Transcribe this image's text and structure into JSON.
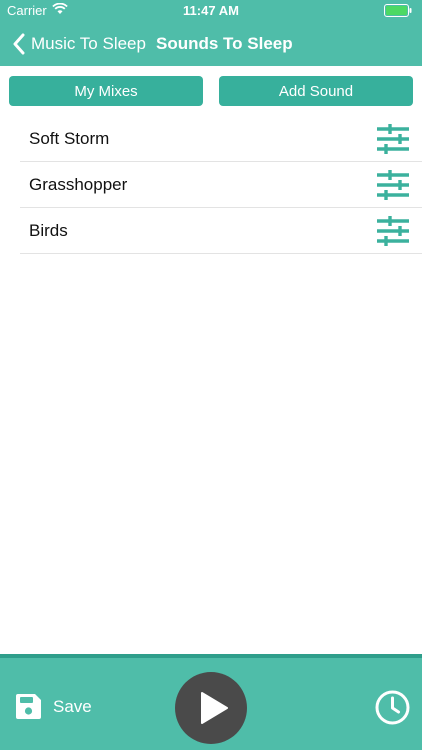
{
  "status_bar": {
    "carrier": "Carrier",
    "time": "11:47 AM"
  },
  "nav": {
    "back_label": "Music To Sleep",
    "title": "Sounds To Sleep"
  },
  "segments": {
    "left": "My Mixes",
    "right": "Add Sound"
  },
  "sounds": [
    {
      "label": "Soft Storm"
    },
    {
      "label": "Grasshopper"
    },
    {
      "label": "Birds"
    }
  ],
  "footer": {
    "save_label": "Save"
  },
  "colors": {
    "accent": "#4fbda9",
    "button": "#37b09c",
    "play": "#4a4a4a",
    "icon": "#3bb19d"
  },
  "icons": [
    "wifi-icon",
    "battery-icon",
    "chevron-left-icon",
    "sliders-icon",
    "save-icon",
    "play-icon",
    "clock-icon"
  ]
}
